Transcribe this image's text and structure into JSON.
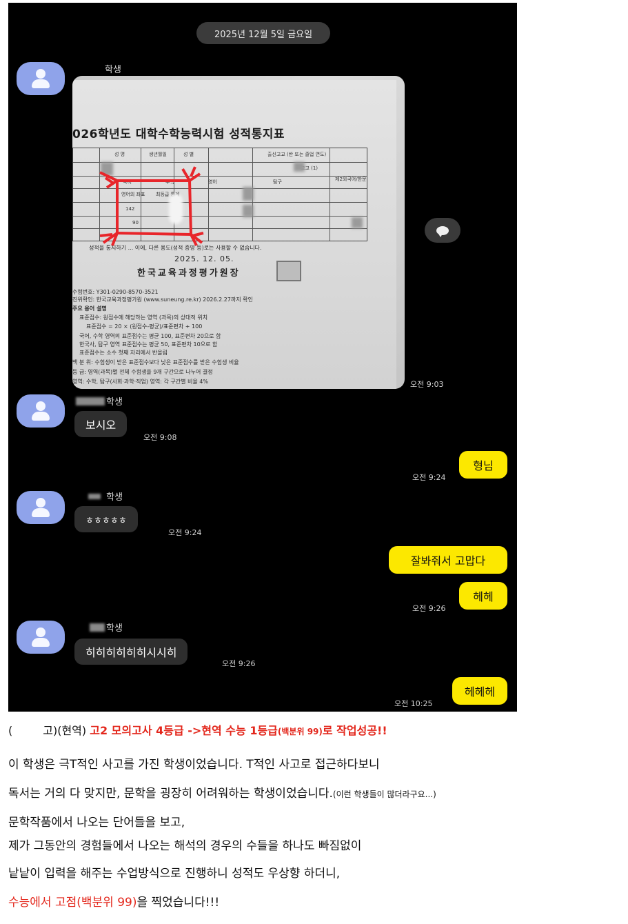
{
  "chat": {
    "date_divider": "2025년 12월 5일 금요일",
    "messages": [
      {
        "sender": "학생",
        "type": "photo",
        "time": "오전 9:03",
        "photo": {
          "title": "026학년도 대학수학능력시험 성적통지표",
          "header_labels": [
            "성 명",
            "생년월일",
            "성 별",
            "출신고교 (반 또는 졸업 연도)"
          ],
          "row2_labels": [
            "국어",
            "수학",
            "영어",
            "탐구",
            "제2외국어/한문"
          ],
          "row3_labels": [
            "영어의 좌표",
            "최등급 통계",
            "고고 (1)"
          ],
          "score_value": "142",
          "score_value2": "90",
          "notice": "성적을 통지하기 ... 이에, 다른 용도(성적 증명 등)로는 사용할 수 없습니다.",
          "issue_date": "2025. 12. 05.",
          "issuer": "한국교육과정평가원장",
          "footnote_lines": [
            "수험번호: Y301-0290-8570-3521",
            "진위확인: 한국교육과정평가원 (www.suneung.re.kr) 2026.2.27까지 확인",
            "주요 용어 설명",
            "표준점수: 원점수에 해당하는 영역 (과목)의 상대적 위치",
            "표준점수 = 20 × (원점수-평균)/표준편차 + 100",
            "국어, 수학 영역의 표준점수는 평균 100, 표준편차 20으로 함",
            "한국사, 탐구 영역 표준점수는 평균 50, 표준편차 10으로 함",
            "표준점수는 소수 첫째 자리에서 반올림",
            "백 분 위: 수험생이 받은 표준점수보다 낮은 표준점수를 받은 수험생 비율",
            "등 급: 영역(과목)별 전체 수험생을 9개 구간으로 나누어 결정",
            "영역: 수학, 탐구(사회·과학·직업) 영역: 각 구간별 비율 4%"
          ]
        }
      },
      {
        "sender": "학생",
        "type": "text",
        "text": "보시오",
        "time": "오전 9:08"
      },
      {
        "sender": "me",
        "type": "text",
        "text": "형님",
        "time": "오전 9:24"
      },
      {
        "sender": "학생",
        "type": "text",
        "text": "ㅎㅎㅎㅎㅎ",
        "time": "오전 9:24"
      },
      {
        "sender": "me",
        "type": "text",
        "text": "잘봐줘서 고맙다"
      },
      {
        "sender": "me",
        "type": "text",
        "text": "헤헤",
        "time": "오전 9:26"
      },
      {
        "sender": "학생",
        "type": "text",
        "text": "히히히히히히시시히",
        "time": "오전 9:26"
      },
      {
        "sender": "me",
        "type": "text",
        "text": "헤헤헤",
        "time": "오전 10:25"
      }
    ]
  },
  "caption": {
    "line1_a": "(",
    "line1_b": "고)(현역) ",
    "line1_red": "고2 모의고사 4등급 ->현역 수능 1등급",
    "line1_red_small": "(백분위 99)",
    "line1_red_end": "로 작업성공!!",
    "line2": "이 학생은 극T적인 사고를 가진 학생이었습니다. T적인 사고로 접근하다보니",
    "line3": "독서는 거의 다 맞지만, 문학을 굉장히 어려워하는 학생이었습니다.",
    "line3_small": "(이런 학생들이 많더라구요...)",
    "line4": "문학작품에서 나오는 단어들을 보고,",
    "line5": "제가 그동안의 경험들에서 나오는 해석의 경우의 수들을 하나도 빠짐없이",
    "line6": "낱낱이 입력을 해주는 수업방식으로 진행하니 성적도 우상향 하더니,",
    "line7_red": "수능에서 고점(백분위 99)",
    "line7_end": "을 찍었습니다!!!"
  },
  "colors": {
    "chat_bg": "#000000",
    "incoming_bubble": "#2e2e2e",
    "outgoing_bubble": "#fce800",
    "avatar": "#8fa3ea",
    "highlight_red": "#e3261b"
  },
  "icons": [
    "person-avatar-icon",
    "speech-bubble-icon"
  ]
}
